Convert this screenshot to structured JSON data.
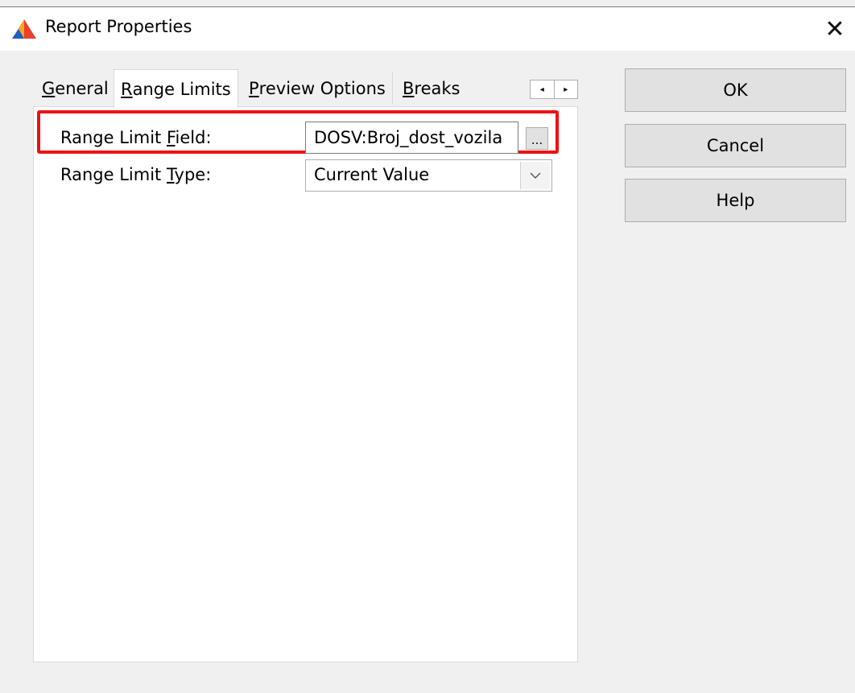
{
  "window": {
    "title": "Report Properties",
    "close_glyph": "✕",
    "icon": "app-logo-icon"
  },
  "tabs": [
    {
      "label_pre": "",
      "label_underline": "G",
      "label_post": "eneral",
      "active": false
    },
    {
      "label_pre": "",
      "label_underline": "R",
      "label_post": "ange Limits",
      "active": true
    },
    {
      "label_pre": "",
      "label_underline": "P",
      "label_post": "review Options",
      "active": false
    },
    {
      "label_pre": "",
      "label_underline": "B",
      "label_post": "reaks",
      "active": false
    }
  ],
  "tab_scroll": {
    "left": "◂",
    "right": "▸"
  },
  "range_limits": {
    "field_label_pre": "Range Limit ",
    "field_label_underline": "F",
    "field_label_post": "ield:",
    "field_value": "DOSV:Broj_dost_vozila",
    "browse_label": "...",
    "type_label_pre": "Range Limit ",
    "type_label_underline": "T",
    "type_label_post": "ype:",
    "type_value": "Current Value"
  },
  "buttons": {
    "ok": "OK",
    "cancel": "Cancel",
    "help": "Help"
  },
  "colors": {
    "highlight": "#ee1111",
    "logo_orange": "#f5a623",
    "logo_blue": "#1f5fbf",
    "logo_red": "#e8412c"
  }
}
